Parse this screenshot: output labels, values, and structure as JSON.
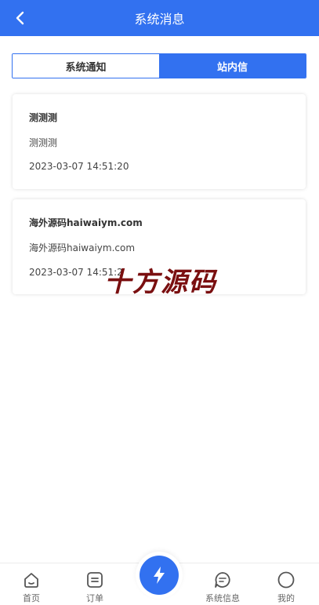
{
  "header": {
    "title": "系统消息"
  },
  "tabs": [
    {
      "label": "系统通知",
      "active": false
    },
    {
      "label": "站内信",
      "active": true
    }
  ],
  "messages": [
    {
      "title": "测测测",
      "body": "测测测",
      "time": "2023-03-07 14:51:20"
    },
    {
      "title": "海外源码haiwaiym.com",
      "body": "海外源码haiwaiym.com",
      "time": "2023-03-07 14:51:2"
    }
  ],
  "watermark": "十方源码",
  "tabbar": [
    {
      "label": "首页",
      "icon": "home-icon"
    },
    {
      "label": "订单",
      "icon": "order-icon"
    },
    {
      "label": "",
      "icon": "lightning-icon"
    },
    {
      "label": "系统信息",
      "icon": "message-icon"
    },
    {
      "label": "我的",
      "icon": "profile-icon"
    }
  ],
  "colors": {
    "primary": "#3271f0",
    "watermark": "#7a0f10"
  }
}
